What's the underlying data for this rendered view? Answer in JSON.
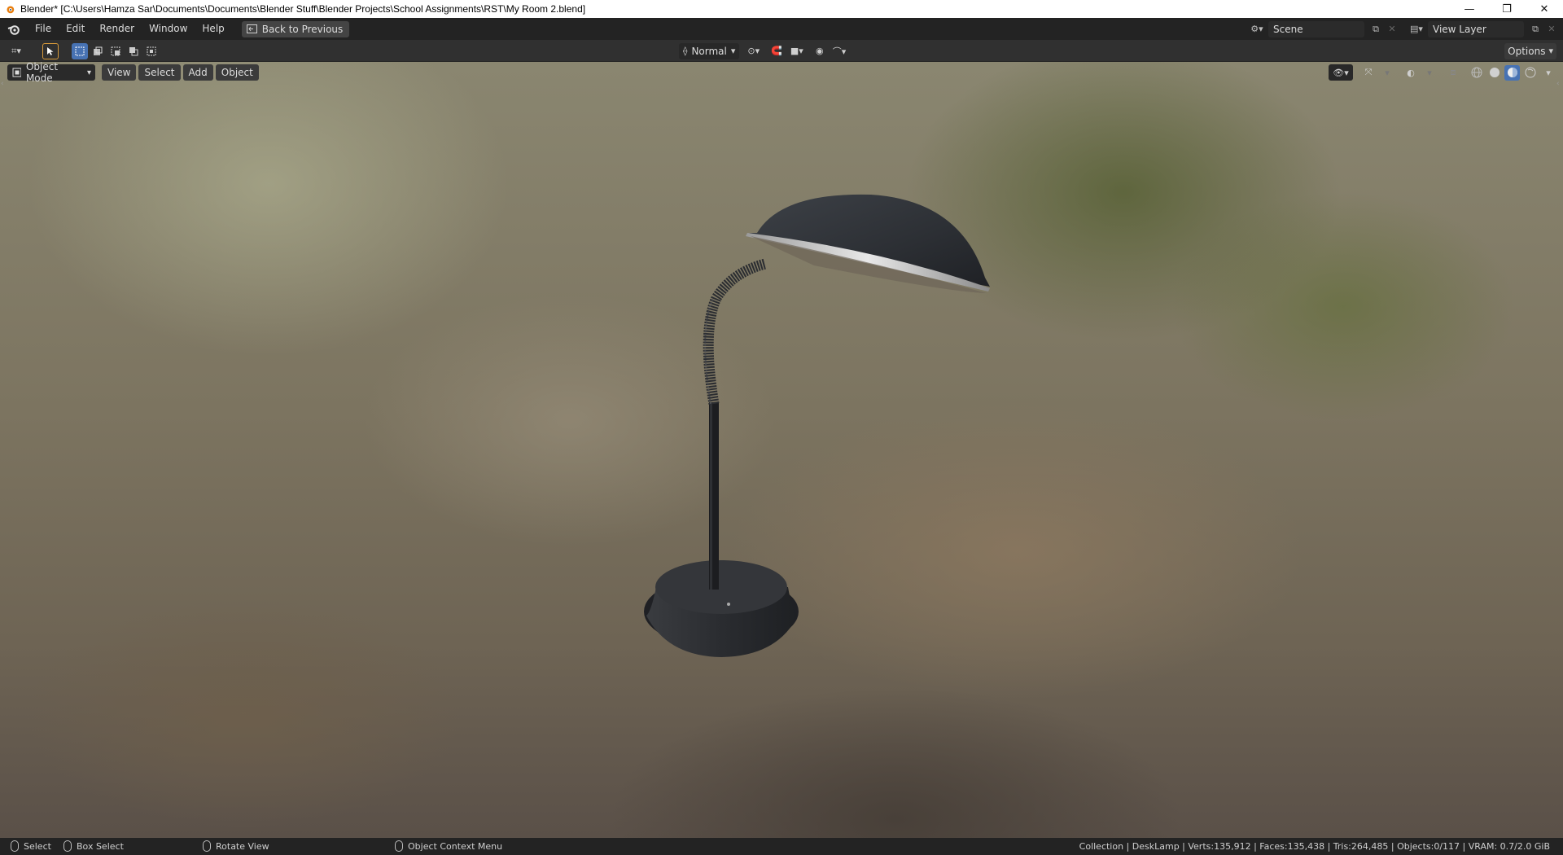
{
  "window": {
    "title": "Blender* [C:\\Users\\Hamza Sar\\Documents\\Documents\\Blender Stuff\\Blender Projects\\School Assignments\\RST\\My Room 2.blend]",
    "minimize_label": "—",
    "restore_label": "❐",
    "close_label": "✕"
  },
  "menubar": {
    "items": [
      "File",
      "Edit",
      "Render",
      "Window",
      "Help"
    ],
    "back_button": "Back to Previous",
    "scene_name": "Scene",
    "view_layer_name": "View Layer"
  },
  "toolbar": {
    "transform_orientation": "Normal",
    "options_label": "Options",
    "select_modes": [
      "select-set",
      "select-extend",
      "select-subtract",
      "select-difference",
      "select-intersect"
    ]
  },
  "viewport": {
    "mode_label": "Object Mode",
    "menus": [
      "View",
      "Select",
      "Add",
      "Object"
    ],
    "object_name": "DeskLamp",
    "shading_modes": [
      "wireframe",
      "solid",
      "material-preview",
      "rendered"
    ],
    "active_shading": "material-preview"
  },
  "statusbar": {
    "hints": [
      {
        "icon": "mouse-left-icon",
        "label": "Select"
      },
      {
        "icon": "mouse-left-drag-icon",
        "label": "Box Select"
      },
      {
        "icon": "mouse-middle-icon",
        "label": "Rotate View"
      },
      {
        "icon": "mouse-right-icon",
        "label": "Object Context Menu"
      }
    ],
    "stats": "Collection | DeskLamp | Verts:135,912 | Faces:135,438 | Tris:264,485 | Objects:0/117 | VRAM: 0.7/2.0 GiB"
  },
  "colors": {
    "accent": "#4772b3",
    "header_bg": "#303030",
    "menubar_bg": "#232323"
  }
}
